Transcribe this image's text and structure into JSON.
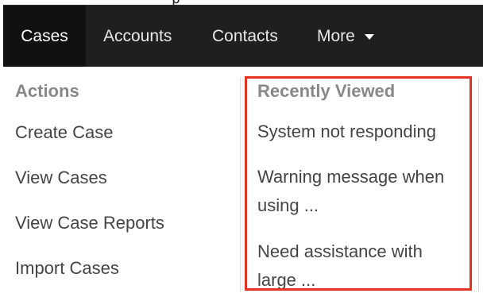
{
  "navbar": {
    "items": [
      {
        "label": "Cases",
        "active": true
      },
      {
        "label": "Accounts",
        "active": false
      },
      {
        "label": "Contacts",
        "active": false
      },
      {
        "label": "More",
        "active": false
      }
    ],
    "more_icon": "caret-down-icon",
    "background": "#1f1f1f",
    "active_background": "#111111"
  },
  "actions": {
    "header": "Actions",
    "items": [
      "Create Case",
      "View Cases",
      "View Case Reports",
      "Import Cases"
    ]
  },
  "recently_viewed": {
    "header": "Recently Viewed",
    "items": [
      "System not responding",
      "Warning message when using ...",
      "Need assistance with large ..."
    ],
    "highlight_color": "#e53323"
  }
}
